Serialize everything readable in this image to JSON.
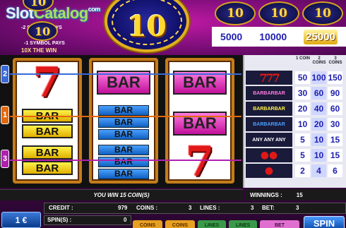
{
  "watermark": {
    "part1": "Slot",
    "part2": "Catalog",
    "suffix": "com"
  },
  "rules": {
    "two_symbol": "-2 SYMBOL PAYS",
    "one_symbol": "-1 SYMBOL PAYS",
    "one_symbol_win": "10X THE WIN"
  },
  "logo": {
    "number": "10"
  },
  "jackpots": {
    "values": [
      "5000",
      "10000",
      "25000"
    ],
    "coin_label": "10"
  },
  "reels": {
    "reel1": [
      "seven",
      "bar-yellow-double",
      "bar-yellow-double"
    ],
    "reel2": [
      "bar-pink",
      "bar-blue-triple",
      "bar-blue-triple"
    ],
    "reel3": [
      "bar-pink",
      "bar-pink",
      "seven"
    ],
    "symbols": {
      "seven": "7",
      "bar": "BAR"
    }
  },
  "paylines": {
    "labels": [
      "2",
      "1",
      "3"
    ],
    "colors": [
      "#3a6ad8",
      "#e06a10",
      "#b020b0"
    ]
  },
  "paytable": {
    "headers": [
      "1 COIN",
      "2 COINS",
      "3 COINS"
    ],
    "rows": [
      {
        "symbol": "777",
        "values": [
          "50",
          "100",
          "150"
        ]
      },
      {
        "symbol": "BARBARBAR",
        "values": [
          "30",
          "60",
          "90"
        ]
      },
      {
        "symbol": "BARBARBAR",
        "values": [
          "20",
          "40",
          "60"
        ]
      },
      {
        "symbol": "BARBARBAR",
        "values": [
          "10",
          "20",
          "30"
        ]
      },
      {
        "symbol": "ANY ANY ANY",
        "values": [
          "5",
          "10",
          "15"
        ]
      },
      {
        "symbol": "cherries",
        "values": [
          "5",
          "10",
          "15"
        ]
      },
      {
        "symbol": "ANY cherries",
        "values": [
          "2",
          "4",
          "6"
        ]
      }
    ]
  },
  "status": {
    "message": "YOU WIN 15 COIN(S)",
    "winnings_label": "WINNINGS :",
    "winnings_value": "15",
    "credit_label": "CREDIT :",
    "credit_value": "979",
    "coins_label": "COINS :",
    "coins_value": "3",
    "lines_label": "LINES :",
    "lines_value": "3",
    "bet_label": "BET:",
    "bet_value": "3",
    "spins_label": "SPIN(S) :",
    "spins_value": "0"
  },
  "controls": {
    "coin_value": "1 €",
    "coins_btn": "COINS",
    "lines_btn": "LINES",
    "bet_btn": "BET",
    "spin_btn": "SPIN"
  },
  "colors": {
    "accent": "#c21aa5",
    "reel_frame": "#c57d1a",
    "spin": "#0a4aaa"
  }
}
